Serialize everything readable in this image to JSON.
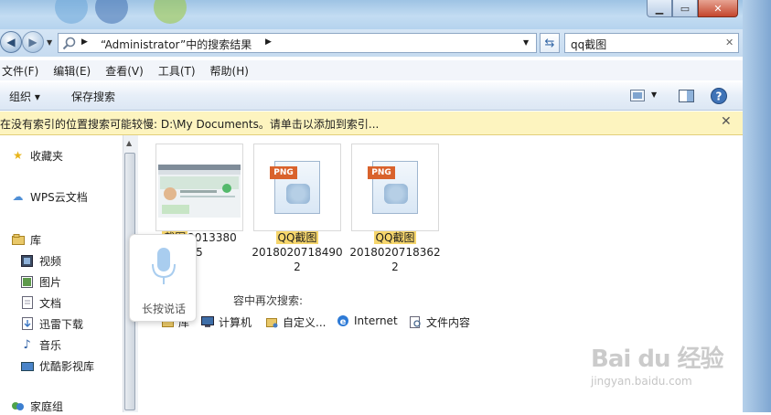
{
  "window": {
    "address_path": "“Administrator”中的搜索结果",
    "search_value": "qq截图",
    "close_glyph": "✕"
  },
  "menu": [
    "文件(F)",
    "编辑(E)",
    "查看(V)",
    "工具(T)",
    "帮助(H)"
  ],
  "toolbar": {
    "organize": "组织 ▾",
    "save_search": "保存搜索"
  },
  "infobar": {
    "text": "在没有索引的位置搜索可能较慢: D:\\My Documents。请单击以添加到索引..."
  },
  "navpane": {
    "items": [
      {
        "label": "收藏夹",
        "icon": "star-icon"
      },
      {
        "label": "WPS云文档",
        "icon": "cloud-icon"
      },
      {
        "label": "库",
        "icon": "library-icon"
      },
      {
        "label": "视频",
        "icon": "video-icon"
      },
      {
        "label": "图片",
        "icon": "picture-icon"
      },
      {
        "label": "文档",
        "icon": "document-icon"
      },
      {
        "label": "迅雷下载",
        "icon": "download-icon"
      },
      {
        "label": "音乐",
        "icon": "music-icon"
      },
      {
        "label": "优酷影视库",
        "icon": "video-library-icon"
      },
      {
        "label": "家庭组",
        "icon": "homegroup-icon"
      }
    ]
  },
  "files": [
    {
      "highlight": "截图",
      "rest_line1": "2013380",
      "line2": "5"
    },
    {
      "highlight": "QQ截图",
      "rest_line1": "2018020718490",
      "line2": "2",
      "badge": "PNG"
    },
    {
      "highlight": "QQ截图",
      "rest_line1": "2018020718362",
      "line2": "2",
      "badge": "PNG"
    }
  ],
  "search_again": {
    "heading": "容中再次搜索:",
    "items": [
      {
        "label": "库",
        "icon": "library-icon"
      },
      {
        "label": "计算机",
        "icon": "computer-icon"
      },
      {
        "label": "自定义...",
        "icon": "folder-icon"
      },
      {
        "label": "Internet",
        "icon": "internet-icon"
      },
      {
        "label": "文件内容",
        "icon": "file-content-icon"
      }
    ]
  },
  "voice": {
    "label": "长按说话"
  },
  "watermark": {
    "logo": "Bai du 经验",
    "url": "jingyan.baidu.com"
  }
}
